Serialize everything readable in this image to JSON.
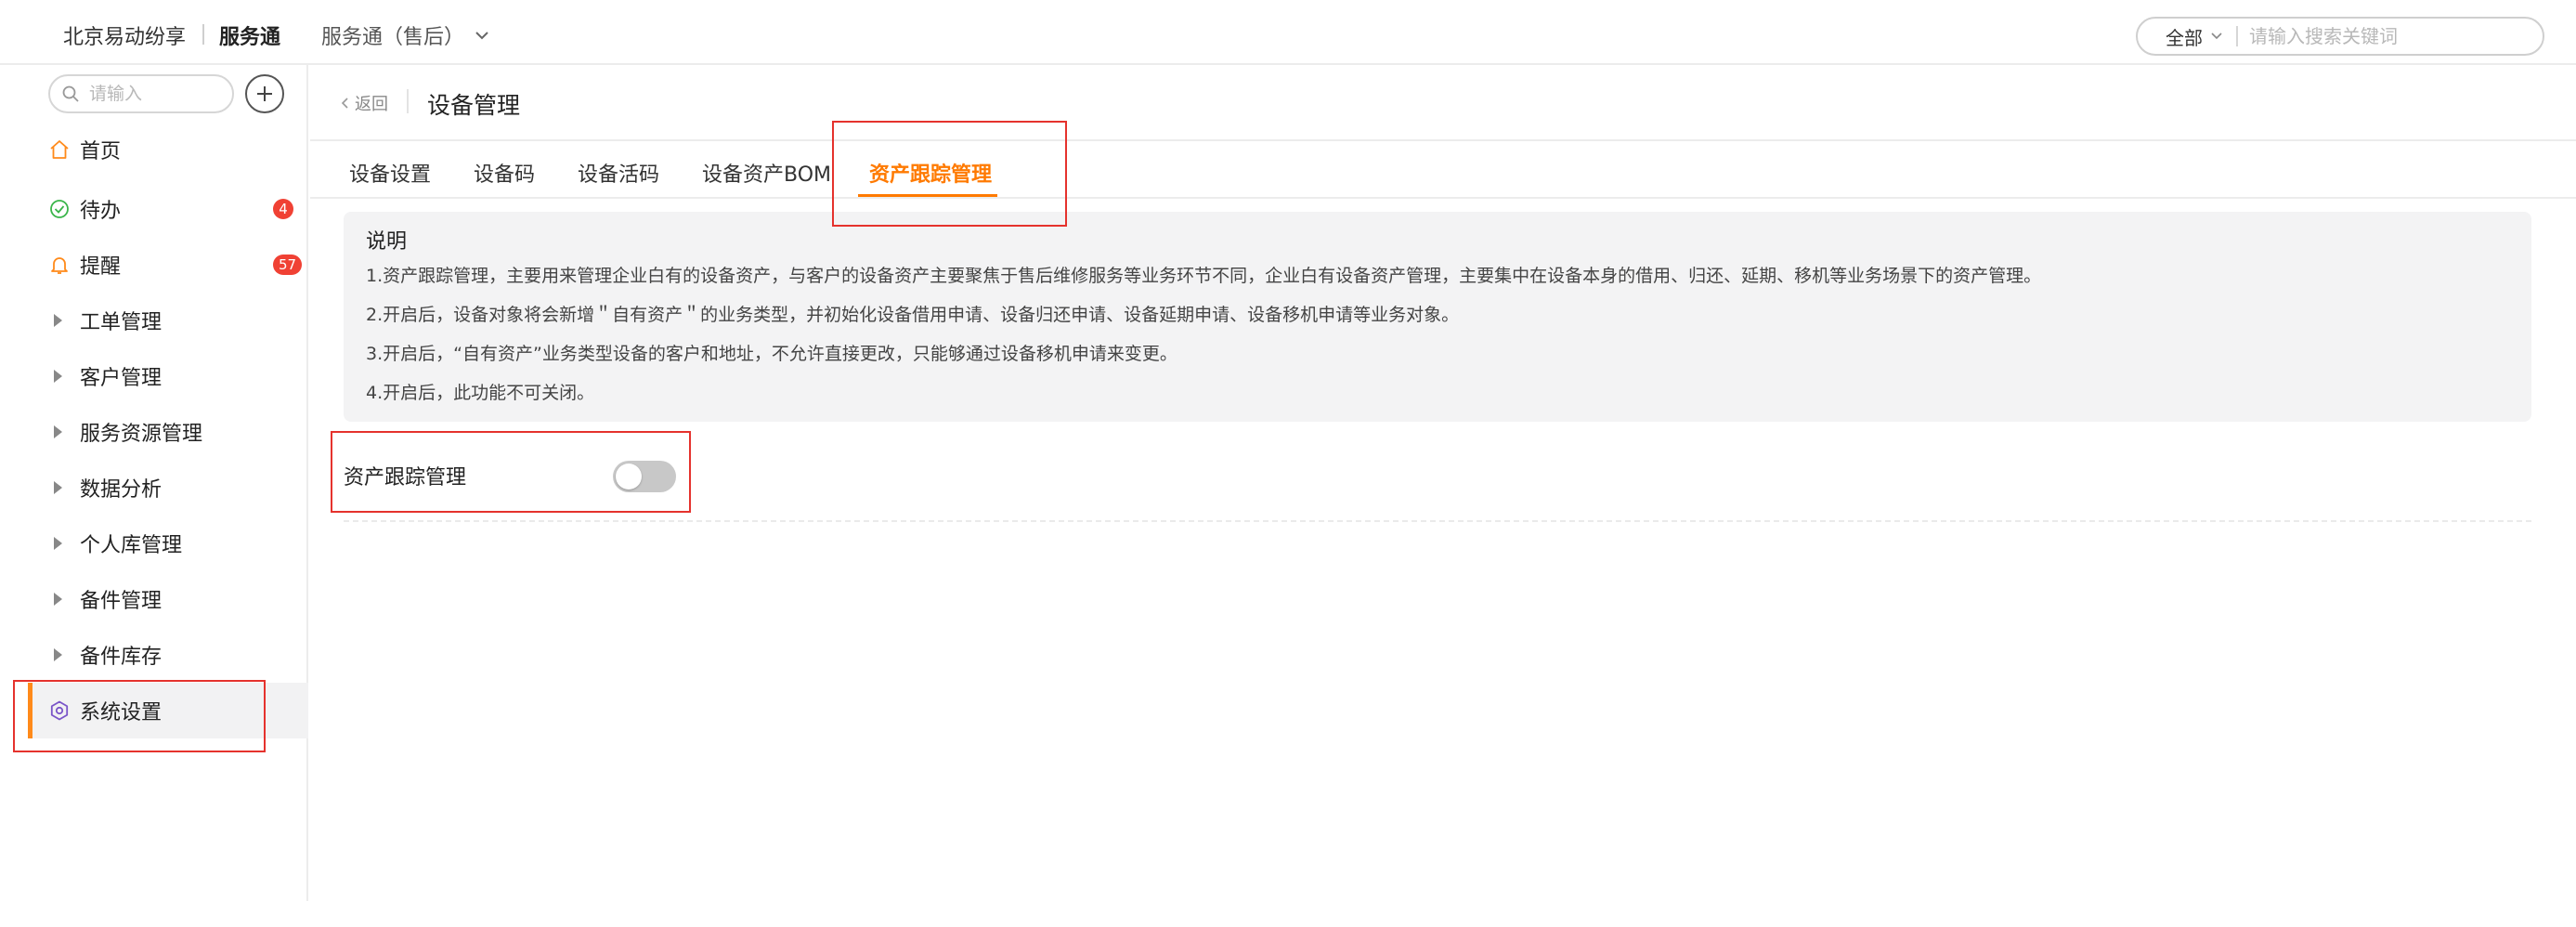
{
  "header": {
    "company": "北京易动纷享",
    "product": "服务通",
    "product_switch": "服务通（售后）",
    "search_scope": "全部",
    "search_placeholder": "请输入搜索关键词"
  },
  "sidebar": {
    "search_placeholder": "请输入",
    "items": [
      {
        "label": "首页",
        "icon": "home-icon"
      },
      {
        "label": "待办",
        "icon": "check-circle-icon",
        "badge": "4"
      },
      {
        "label": "提醒",
        "icon": "bell-icon",
        "badge": "57"
      },
      {
        "label": "工单管理",
        "icon": "caret-right-icon"
      },
      {
        "label": "客户管理",
        "icon": "caret-right-icon"
      },
      {
        "label": "服务资源管理",
        "icon": "caret-right-icon"
      },
      {
        "label": "数据分析",
        "icon": "caret-right-icon"
      },
      {
        "label": "个人库管理",
        "icon": "caret-right-icon"
      },
      {
        "label": "备件管理",
        "icon": "caret-right-icon"
      },
      {
        "label": "备件库存",
        "icon": "caret-right-icon"
      },
      {
        "label": "系统设置",
        "icon": "gear-icon",
        "active": true
      }
    ]
  },
  "page": {
    "back_label": "返回",
    "title": "设备管理",
    "tabs": [
      "设备设置",
      "设备码",
      "设备活码",
      "设备资产BOM",
      "资产跟踪管理"
    ],
    "active_tab": "资产跟踪管理"
  },
  "notice": {
    "title": "说明",
    "lines": [
      "1.资产跟踪管理，主要用来管理企业白有的设备资产，与客户的设备资产主要聚焦于售后维修服务等业务环节不同，企业白有设备资产管理，主要集中在设备本身的借用、归还、延期、移机等业务场景下的资产管理。",
      "2.开启后，设备对象将会新增＂自有资产＂的业务类型，并初始化设备借用申请、设备归还申请、设备延期申请、设备移机申请等业务对象。",
      "3.开启后，“自有资产”业务类型设备的客户和地址，不允许直接更改，只能够通过设备移机申请来变更。",
      "4.开启后，此功能不可关闭。"
    ]
  },
  "setting": {
    "label": "资产跟踪管理",
    "enabled": false
  },
  "colors": {
    "accent": "#ff7a00",
    "badge": "#f04134",
    "highlight": "#e5322d"
  }
}
